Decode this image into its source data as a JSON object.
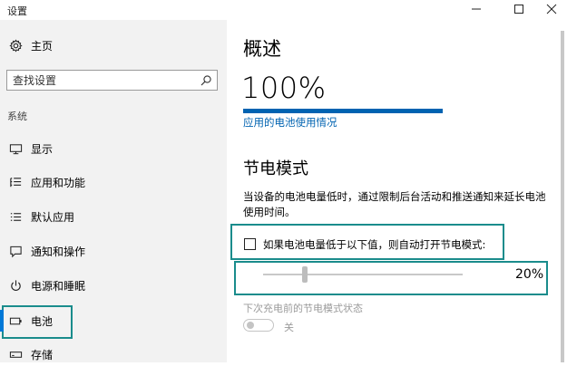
{
  "window": {
    "title": "设置"
  },
  "sidebar": {
    "home_label": "主页",
    "search_placeholder": "查找设置",
    "section_label": "系统",
    "items": [
      {
        "label": "显示",
        "icon": "monitor-icon"
      },
      {
        "label": "应用和功能",
        "icon": "apps-list-icon"
      },
      {
        "label": "默认应用",
        "icon": "default-apps-icon"
      },
      {
        "label": "通知和操作",
        "icon": "notifications-icon"
      },
      {
        "label": "电源和睡眠",
        "icon": "power-icon"
      },
      {
        "label": "电池",
        "icon": "battery-icon",
        "active": true
      },
      {
        "label": "存储",
        "icon": "storage-icon"
      }
    ]
  },
  "main": {
    "overview_title": "概述",
    "battery_percent": "100%",
    "battery_level": 1.0,
    "usage_link": "应用的电池使用情况",
    "saver_title": "节电模式",
    "saver_desc": "当设备的电池电量低时，通过限制后台活动和推送通知来延长电池使用时间。",
    "auto_on_label": "如果电池电量低于以下值，则自动打开节电模式:",
    "auto_on_checked": false,
    "threshold_value": "20%",
    "threshold_level": 0.2,
    "state_label": "下次充电前的节电模式状态",
    "toggle_state": "关"
  },
  "colors": {
    "accent": "#0063b1",
    "highlight": "#1a8c8c",
    "sidebar_bg": "#f2f2f2"
  }
}
